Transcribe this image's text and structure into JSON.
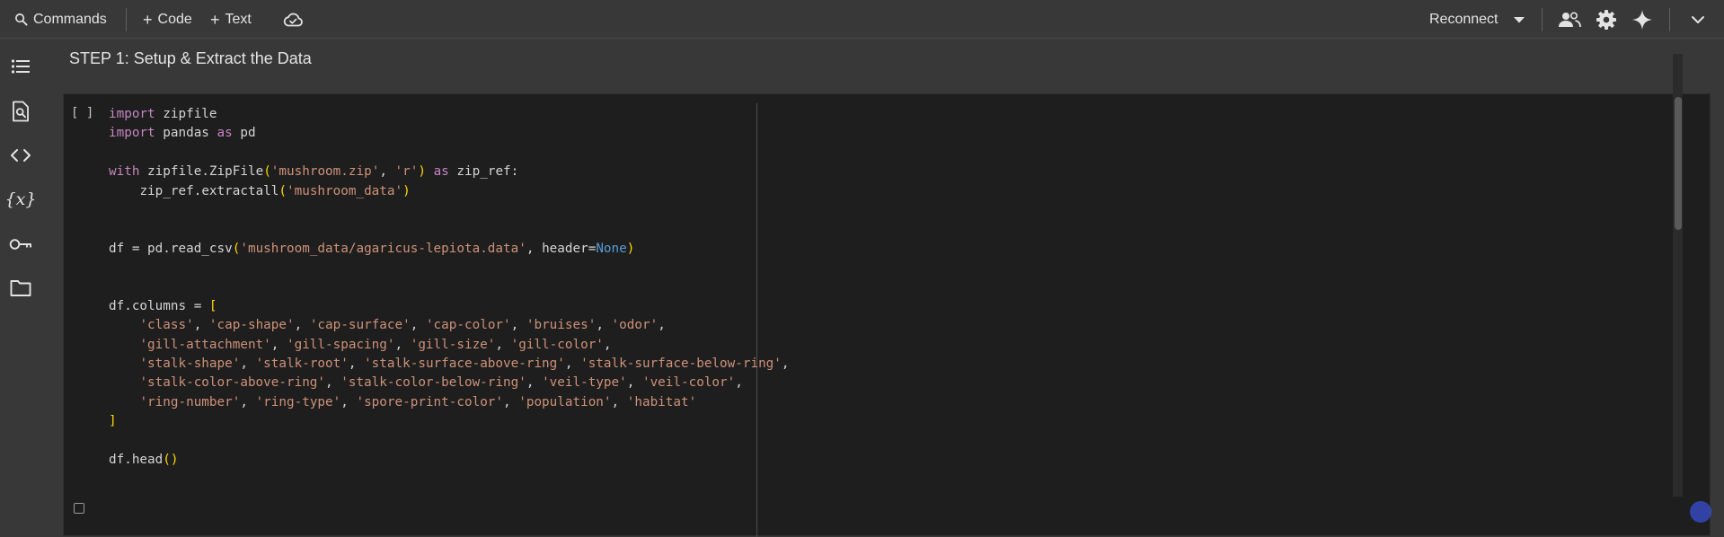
{
  "toolbar": {
    "commands_label": "Commands",
    "add_code_label": "Code",
    "add_text_label": "Text",
    "reconnect_label": "Reconnect"
  },
  "icons": {
    "search": "search-icon",
    "cloud": "cloud-sync-icon",
    "share": "people-icon",
    "settings": "gear-icon",
    "gemini": "sparkle-icon",
    "expand": "chevron-down-icon",
    "toc": "table-of-contents-icon",
    "find": "find-in-page-icon",
    "snippets": "code-brackets-icon",
    "variables": "variables-icon",
    "secrets": "key-icon",
    "files": "folder-icon"
  },
  "notebook": {
    "section_heading": "STEP 1: Setup & Extract the Data",
    "cell": {
      "run_indicator": "[ ]",
      "lines": [
        "import zipfile",
        "import pandas as pd",
        "",
        "with zipfile.ZipFile('mushroom.zip', 'r') as zip_ref:",
        "    zip_ref.extractall('mushroom_data')",
        "",
        "",
        "df = pd.read_csv('mushroom_data/agaricus-lepiota.data', header=None)",
        "",
        "",
        "df.columns = [",
        "    'class', 'cap-shape', 'cap-surface', 'cap-color', 'bruises', 'odor',",
        "    'gill-attachment', 'gill-spacing', 'gill-size', 'gill-color',",
        "    'stalk-shape', 'stalk-root', 'stalk-surface-above-ring', 'stalk-surface-below-ring',",
        "    'stalk-color-above-ring', 'stalk-color-below-ring', 'veil-type', 'veil-color',",
        "    'ring-number', 'ring-type', 'spore-print-color', 'population', 'habitat'",
        "]",
        "",
        "df.head()"
      ]
    }
  },
  "colors": {
    "background": "#383838",
    "cell_background": "#1e1e1e",
    "keyword": "#c586c0",
    "string": "#ce9178",
    "none_literal": "#569cd6",
    "bracket": "#ffd700",
    "text": "#d4d4d4"
  }
}
